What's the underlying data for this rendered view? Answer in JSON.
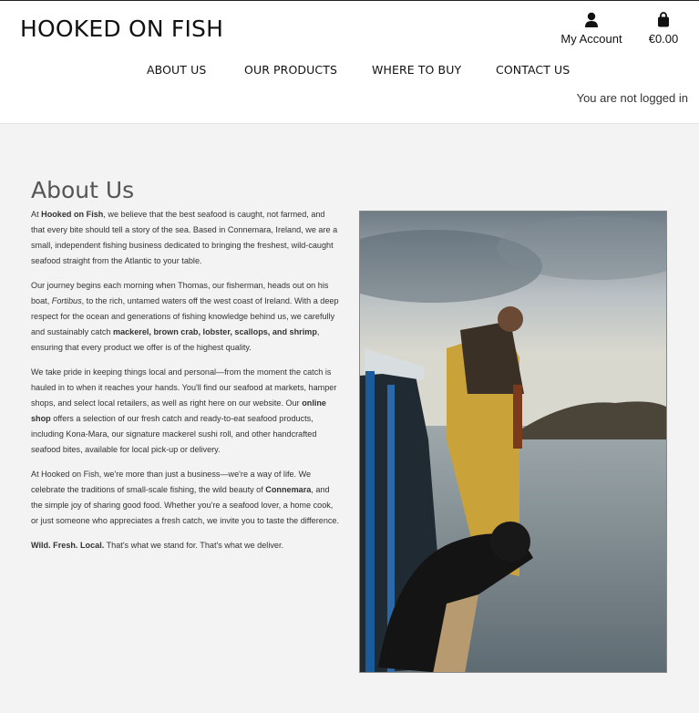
{
  "header": {
    "logo": "HOOKED ON FISH",
    "account_label": "My Account",
    "cart_total": "€0.00",
    "login_status": "You are not logged in"
  },
  "nav": {
    "items": [
      {
        "label": "ABOUT US"
      },
      {
        "label": "OUR PRODUCTS"
      },
      {
        "label": "WHERE TO BUY"
      },
      {
        "label": "CONTACT US"
      }
    ]
  },
  "about": {
    "title": "About Us",
    "p1": {
      "a": "At ",
      "b": "Hooked on Fish",
      "c": ", we believe that the best seafood is caught, not farmed, and that every bite should tell a story of the sea. Based in Connemara, Ireland, we are a small, independent fishing business dedicated to bringing the freshest, wild-caught seafood straight from the Atlantic to your table."
    },
    "p2": {
      "a": "Our journey begins each morning when Thomas, our fisherman, heads out on his boat, ",
      "b": "Fortibus",
      "c": ", to the rich, untamed waters off the west coast of Ireland. With a deep respect for the ocean and generations of fishing knowledge behind us, we carefully and sustainably catch ",
      "d": "mackerel, brown crab, lobster, scallops, and shrimp",
      "e": ", ensuring that every product we offer is of the highest quality."
    },
    "p3": {
      "a": "We take pride in keeping things local and personal—from the moment the catch is hauled in to when it reaches your hands. You'll find our seafood at markets, hamper shops, and select local retailers, as well as right here on our website. Our ",
      "b": "online shop",
      "c": " offers a selection of our fresh catch and ready-to-eat seafood products, including Kona-Mara, our signature mackerel sushi roll, and other handcrafted seafood bites, available for local pick-up or delivery."
    },
    "p4": {
      "a": "At Hooked on Fish, we're more than just a business—we're a way of life. We celebrate the traditions of small-scale fishing, the wild beauty of ",
      "b": "Connemara",
      "c": ", and the simple joy of sharing good food. Whether you're a seafood lover, a home cook, or just someone who appreciates a fresh catch, we invite you to taste the difference."
    },
    "p5": {
      "a": "Wild. Fresh. Local.",
      "b": " That's what we stand for. That's what we deliver."
    }
  },
  "icons": {
    "account": "user-icon",
    "cart": "shopping-bag-icon"
  }
}
